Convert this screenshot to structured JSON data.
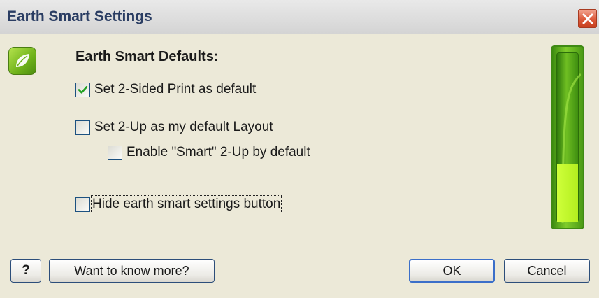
{
  "window": {
    "title": "Earth Smart Settings"
  },
  "icons": {
    "close": "close-icon",
    "app": "leaf-icon",
    "help": "question-icon"
  },
  "section": {
    "heading": "Earth Smart Defaults:"
  },
  "options": [
    {
      "label": "Set 2-Sided Print as default",
      "checked": true
    },
    {
      "label": "Set 2-Up as my default Layout",
      "checked": false
    },
    {
      "label": "Enable \"Smart\" 2-Up by default",
      "checked": false
    },
    {
      "label": "Hide earth smart settings button",
      "checked": false
    }
  ],
  "meter": {
    "level": 0.34
  },
  "buttons": {
    "help": "?",
    "more": "Want to know more?",
    "ok": "OK",
    "cancel": "Cancel"
  }
}
